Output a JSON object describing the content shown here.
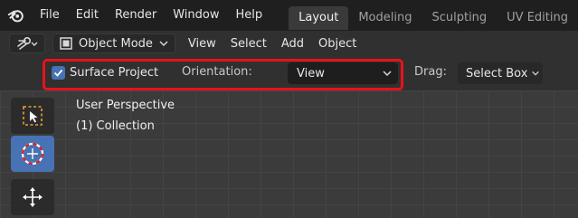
{
  "topbar": {
    "menus": [
      "File",
      "Edit",
      "Render",
      "Window",
      "Help"
    ],
    "tabs": [
      {
        "label": "Layout",
        "active": true
      },
      {
        "label": "Modeling",
        "active": false
      },
      {
        "label": "Sculpting",
        "active": false
      },
      {
        "label": "UV Editing",
        "active": false
      }
    ]
  },
  "header": {
    "mode_label": "Object Mode",
    "menus": [
      "View",
      "Select",
      "Add",
      "Object"
    ]
  },
  "tool_settings": {
    "surface_project_label": "Surface Project",
    "surface_project_checked": true,
    "orientation_label": "Orientation:",
    "orientation_value": "View",
    "drag_label": "Drag:",
    "drag_value": "Select Box"
  },
  "viewport": {
    "perspective_label": "User Perspective",
    "collection_label": "(1) Collection"
  },
  "colors": {
    "accent": "#4772b3",
    "highlight": "#e8111d"
  }
}
